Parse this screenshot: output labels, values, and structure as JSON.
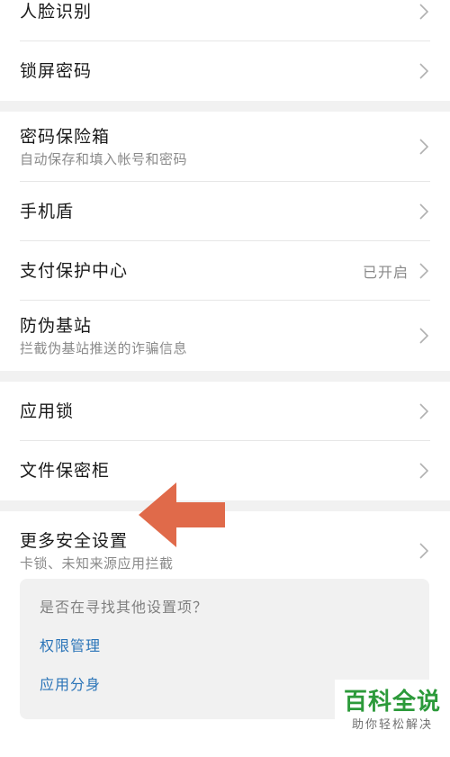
{
  "groups": [
    {
      "items": [
        {
          "title": "人脸识别"
        },
        {
          "title": "锁屏密码"
        }
      ]
    },
    {
      "items": [
        {
          "title": "密码保险箱",
          "subtitle": "自动保存和填入帐号和密码"
        },
        {
          "title": "手机盾"
        },
        {
          "title": "支付保护中心",
          "status": "已开启"
        },
        {
          "title": "防伪基站",
          "subtitle": "拦截伪基站推送的诈骗信息"
        }
      ]
    },
    {
      "items": [
        {
          "title": "应用锁"
        },
        {
          "title": "文件保密柜"
        }
      ]
    },
    {
      "items": [
        {
          "title": "更多安全设置",
          "subtitle": "卡锁、未知来源应用拦截"
        }
      ]
    }
  ],
  "suggestions": {
    "question": "是否在寻找其他设置项？",
    "links": [
      "权限管理",
      "应用分身"
    ]
  },
  "watermark": {
    "main": "百科全说",
    "sub": "助你轻松解决"
  },
  "colors": {
    "accent_link": "#2a74b8",
    "annotation_arrow": "#e06a4a",
    "watermark_green": "#2c9a3a"
  }
}
